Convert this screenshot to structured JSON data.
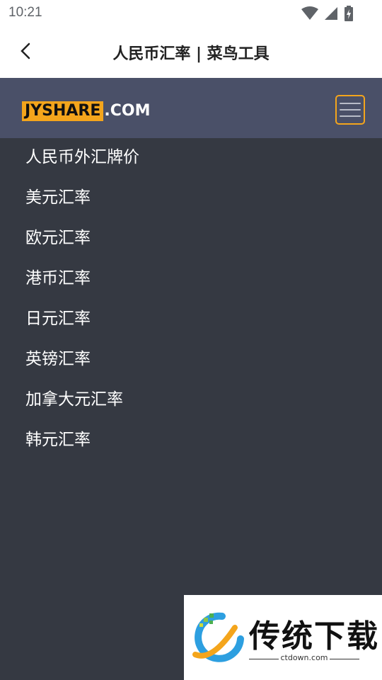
{
  "status_bar": {
    "time": "10:21",
    "icons": [
      "wifi-icon",
      "signal-icon",
      "battery-charging-icon"
    ]
  },
  "app_bar": {
    "back_icon": "back-arrow-icon",
    "title": "人民币汇率 | 菜鸟工具"
  },
  "site_header": {
    "logo_boxed": "JYSHARE",
    "logo_suffix": ".COM",
    "menu_icon": "hamburger-menu-icon",
    "accent_color": "#f4a51c"
  },
  "nav": {
    "items": [
      {
        "label": "人民币外汇牌价"
      },
      {
        "label": "美元汇率"
      },
      {
        "label": "欧元汇率"
      },
      {
        "label": "港币汇率"
      },
      {
        "label": "日元汇率"
      },
      {
        "label": "英镑汇率"
      },
      {
        "label": "加拿大元汇率"
      },
      {
        "label": "韩元汇率"
      }
    ]
  },
  "watermark": {
    "title": "传统下载",
    "subtitle": "ctdown.com"
  },
  "colors": {
    "header_bg": "#4a5068",
    "body_bg": "#353942",
    "text": "#ffffff"
  }
}
